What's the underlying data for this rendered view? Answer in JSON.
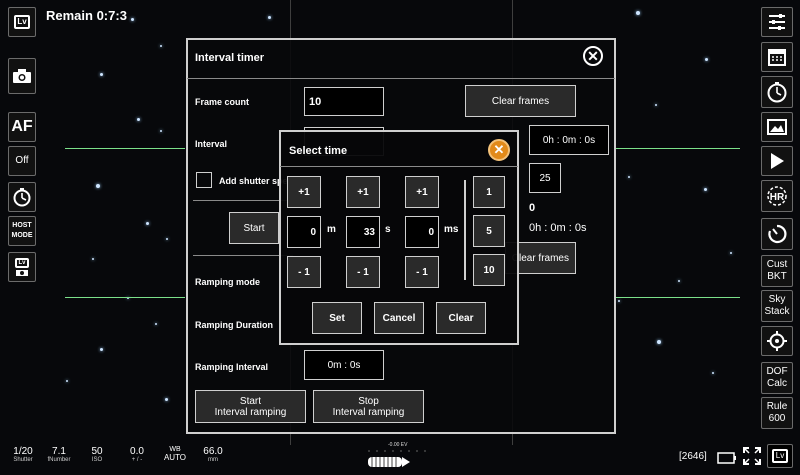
{
  "status": {
    "remain": "Remain 0:7:3",
    "frame_count_badge": "[2646]"
  },
  "left_toolbar": {
    "lv_label": "Lv",
    "af_label": "AF",
    "off_label": "Off",
    "host_mode_label": "HOST\nMODE",
    "lv_small_label": "Lv"
  },
  "right_toolbar": {
    "cust_bkt": "Cust\nBKT",
    "sky_stack": "Sky\nStack",
    "dof_calc": "DOF\nCalc",
    "rule_600": "Rule\n600",
    "lv_label": "Lv"
  },
  "interval_timer": {
    "title": "Interval timer",
    "frame_count_label": "Frame count",
    "frame_count_value": "10",
    "clear_frames": "Clear frames",
    "interval_label": "Interval",
    "interval_value": "0h : 0m : 0s",
    "add_shutter_label": "Add shutter speed",
    "extra_value": "25",
    "zero_value": "0",
    "total_time": "0h : 0m : 0s",
    "start_label": "Start",
    "clear_frames_2": "Clear frames",
    "ramping_mode_label": "Ramping mode",
    "ramping_duration_label": "Ramping Duration",
    "ramping_interval_label": "Ramping Interval",
    "ramping_interval_value": "0m : 0s",
    "start_ramping": "Start\nInterval ramping",
    "stop_ramping": "Stop\nInterval ramping"
  },
  "select_time": {
    "title": "Select time",
    "plus_label": "+1",
    "minus_label": "- 1",
    "minutes_value": "0",
    "minutes_unit": "m",
    "seconds_value": "33",
    "seconds_unit": "s",
    "ms_value": "0",
    "ms_unit": "ms",
    "step_1": "1",
    "step_5": "5",
    "step_10": "10",
    "set_label": "Set",
    "cancel_label": "Cancel",
    "clear_label": "Clear"
  },
  "bottom_bar": {
    "shutter_value": "1/20",
    "shutter_key": "Shutter",
    "fnumber_value": "7.1",
    "fnumber_key": "fNumber",
    "iso_value": "50",
    "iso_key": "ISO",
    "ev_value": "0.0",
    "ev_key": "+ / -",
    "wb_key": "WB",
    "wb_value": "AUTO",
    "focal_value": "66.0",
    "focal_key": "mm",
    "exposure_readout": "-0.00 EV"
  }
}
